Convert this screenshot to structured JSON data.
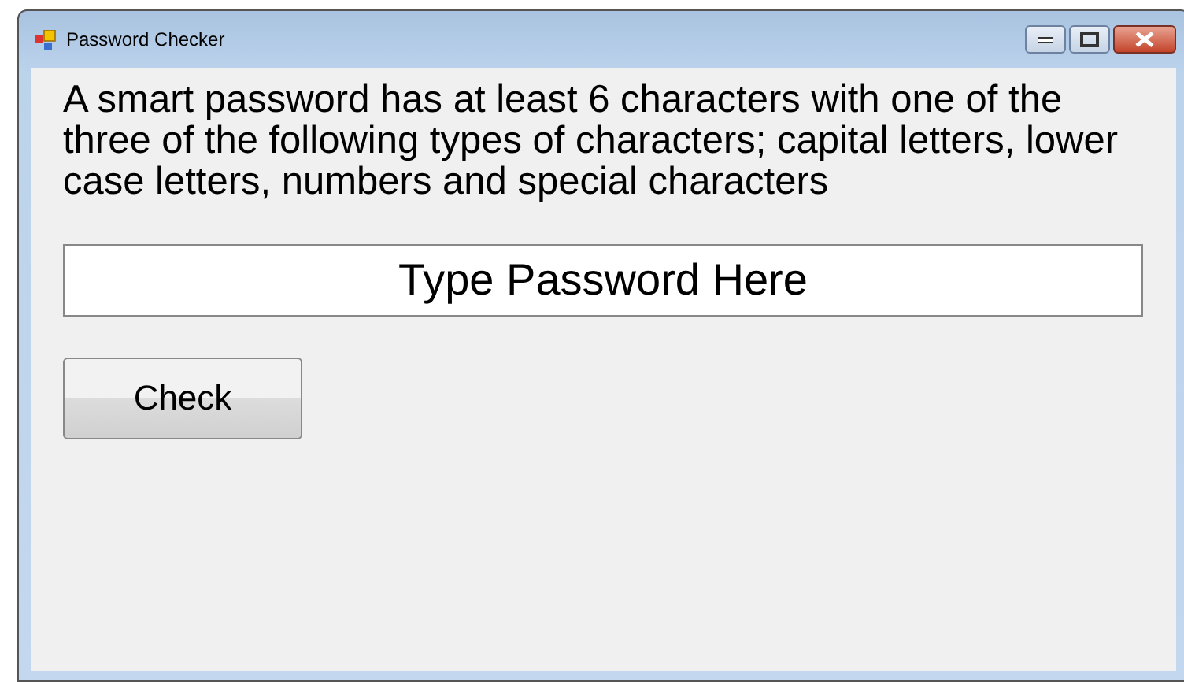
{
  "window": {
    "title": "Password Checker"
  },
  "description": "A smart password has at least 6 characters with one of the three of the following types of characters; capital letters, lower case letters, numbers and special characters",
  "password_field": {
    "value": "Type Password Here"
  },
  "buttons": [
    "Check"
  ]
}
